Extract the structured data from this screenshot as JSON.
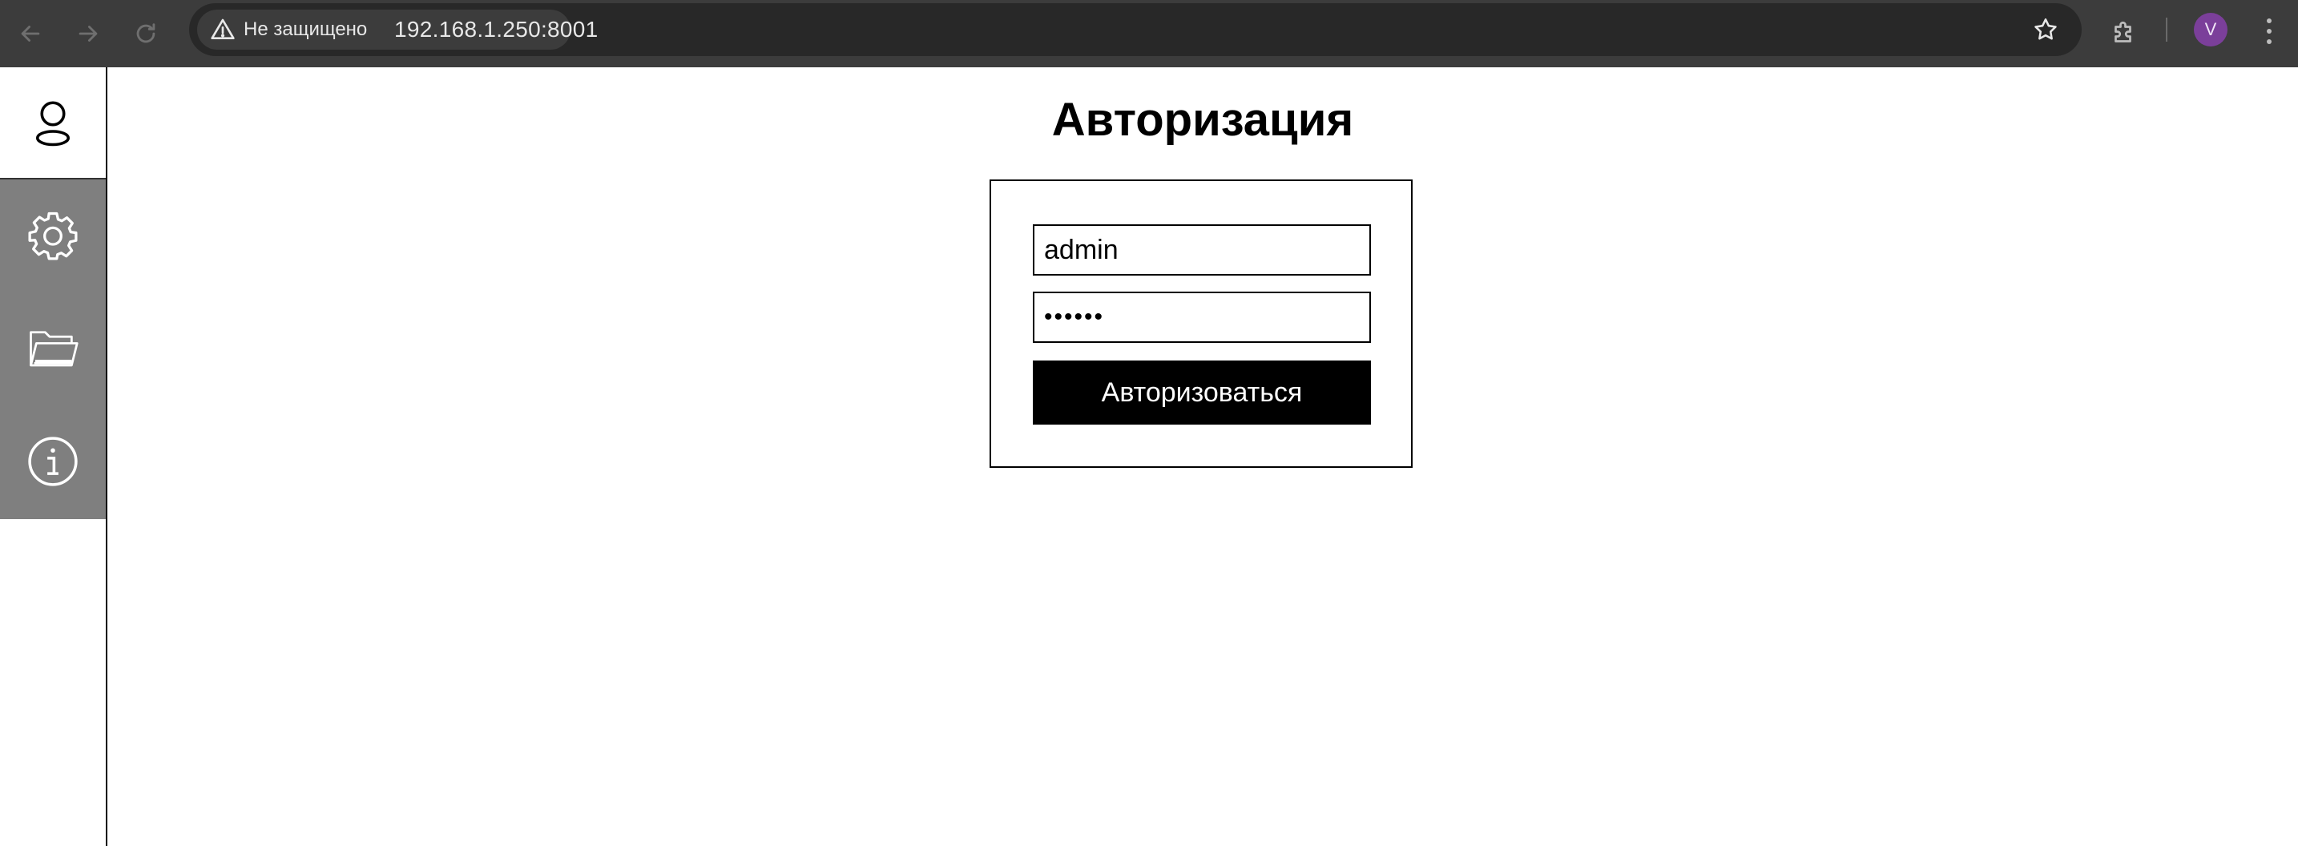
{
  "browser": {
    "security_label": "Не защищено",
    "url": "192.168.1.250:8001",
    "avatar_letter": "V",
    "avatar_color": "#7b3f9a",
    "icons": {
      "back": "arrow-left-icon",
      "forward": "arrow-right-icon",
      "reload": "reload-icon",
      "warning": "warning-triangle-icon",
      "bookmark": "star-icon",
      "extensions": "puzzle-icon",
      "menu": "kebab-menu-icon"
    }
  },
  "sidebar": {
    "items": [
      {
        "name": "profile",
        "icon": "user-icon"
      },
      {
        "name": "settings",
        "icon": "gear-icon"
      },
      {
        "name": "files",
        "icon": "folder-open-icon"
      },
      {
        "name": "info",
        "icon": "info-icon"
      }
    ],
    "active_bg": "#7f7f7f"
  },
  "main": {
    "title": "Авторизация",
    "form": {
      "login_value": "admin",
      "password_value": "••••••",
      "submit_label": "Авторизоваться"
    }
  }
}
